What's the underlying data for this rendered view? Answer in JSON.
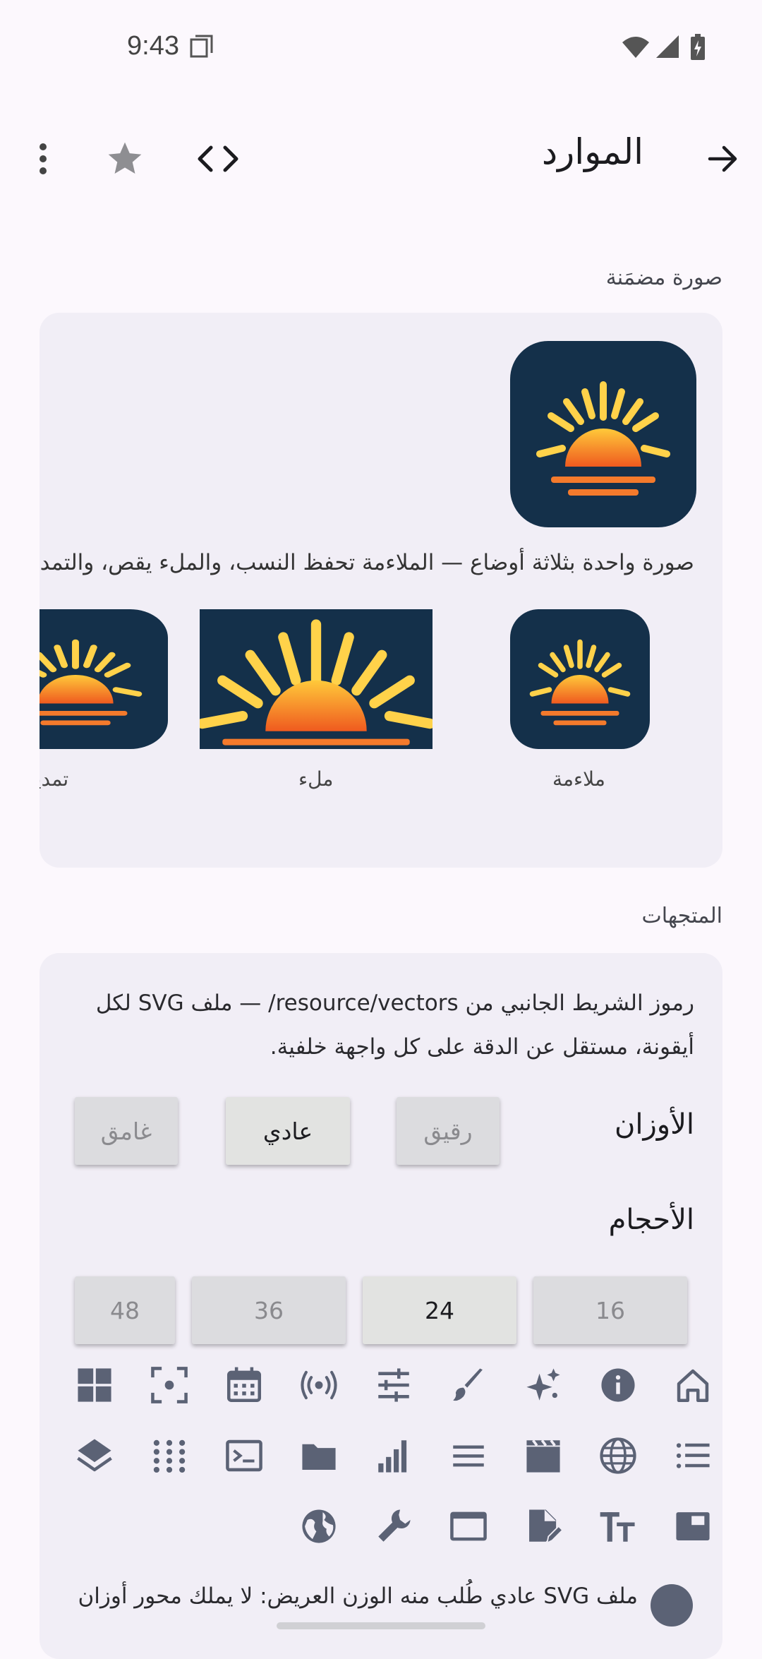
{
  "status": {
    "time": "9:43"
  },
  "appbar": {
    "title": "الموارد"
  },
  "embedded": {
    "section_label": "صورة مضمَنة",
    "description": "صورة واحدة بثلاثة أوضاع — الملاءمة تحفظ النسب، والملء يقص، والتمديد",
    "labels": {
      "fit": "ملاءمة",
      "fill": "ملء",
      "stretch": "تمديد"
    }
  },
  "vectors": {
    "section_label": "المتجهات",
    "description": "رموز الشريط الجانبي من resource/vectors/ — ملف SVG لكل أيقونة، مستقل عن الدقة على كل واجهة خلفية.",
    "weights_label": "الأوزان",
    "weights": [
      "رقيق",
      "عادي",
      "غامق"
    ],
    "sizes_label": "الأحجام",
    "sizes": [
      "16",
      "24",
      "36",
      "48"
    ],
    "icons": [
      "home-icon",
      "info-icon",
      "sparkles-icon",
      "brush-icon",
      "tune-icon",
      "broadcast-icon",
      "calendar-icon",
      "focus-icon",
      "grid-icon",
      "list-icon",
      "globe-icon",
      "movie-icon",
      "menu-lines-icon",
      "bar-chart-icon",
      "folder-icon",
      "terminal-icon",
      "dots-grid-icon",
      "layers-icon",
      "wallpaper-icon",
      "text-size-icon",
      "edit-document-icon",
      "window-icon",
      "wrench-icon",
      "earth-icon"
    ],
    "footer_text": "ملف SVG عادي طُلب منه الوزن العريض: لا يملك محور أوزان"
  },
  "colors": {
    "accent": "#5b6275",
    "icon": "#5b6275",
    "sun_bg": "#14304a"
  }
}
